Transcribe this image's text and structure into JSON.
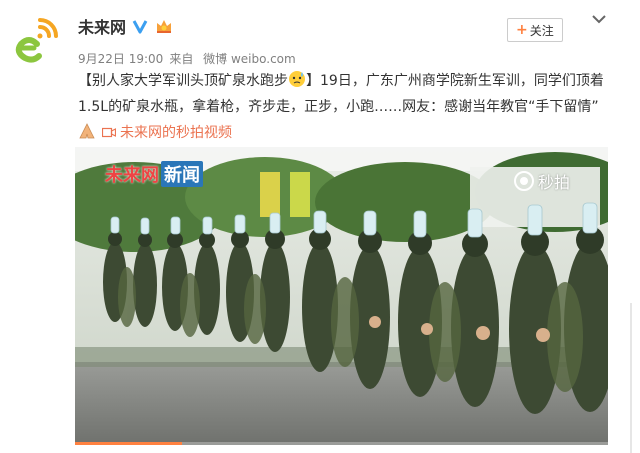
{
  "post": {
    "author": "未来网",
    "time": "9月22日 19:00",
    "source_prefix": "来自",
    "source": "微博 weibo.com",
    "follow_label": "+关注",
    "follow_text": "关注",
    "headline": "【别人家大学军训头顶矿泉水跑步",
    "headline_close": "】19日，广东广州商学院新生军训，同学们顶着1.5L的矿泉水瓶，拿着枪，齐步走，正步，小跑……网友：感谢当年教官“手下留情”",
    "video_link": "未来网的秒拍视频"
  },
  "video": {
    "watermark_brand": "未来网",
    "watermark_news": "新闻",
    "platform_label": "秒拍",
    "progress": 0.2
  },
  "icons": {
    "verified": "verified-v-icon",
    "vip": "vip-crown-icon",
    "more": "chevron-down-icon",
    "video": "video-camera-icon",
    "emoji_sweat": "sweat-emoji-icon",
    "emoji_pray": "pray-hands-emoji-icon"
  },
  "colors": {
    "accent": "#eb7350",
    "follow_plus": "#ff8140",
    "verified": "#3b9ff0",
    "meta": "#808080"
  }
}
